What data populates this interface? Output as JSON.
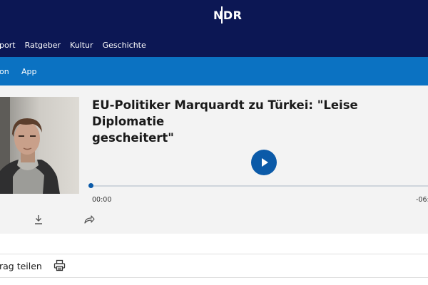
{
  "header": {
    "logo_text": "NDR",
    "nav_items": [
      "port",
      "Ratgeber",
      "Kultur",
      "Geschichte"
    ]
  },
  "subnav": {
    "items": [
      "on",
      "App"
    ]
  },
  "article": {
    "title_line1": "EU-Politiker Marquardt zu Türkei: \"Leise Diplomatie",
    "title_line2": "gescheitert\"",
    "image_icon": "portrait-photo"
  },
  "player": {
    "current_time": "00:00",
    "remaining_time": "-06:",
    "progress": 0
  },
  "actions": {
    "download_icon": "download-icon",
    "share_icon": "share-arrow-icon",
    "share_label": "rag teilen",
    "print_icon": "printer-icon"
  },
  "colors": {
    "header_bg": "#0c1754",
    "subnav_bg": "#0b72c2",
    "accent": "#0b5aa8",
    "card_bg": "#f3f3f3"
  }
}
